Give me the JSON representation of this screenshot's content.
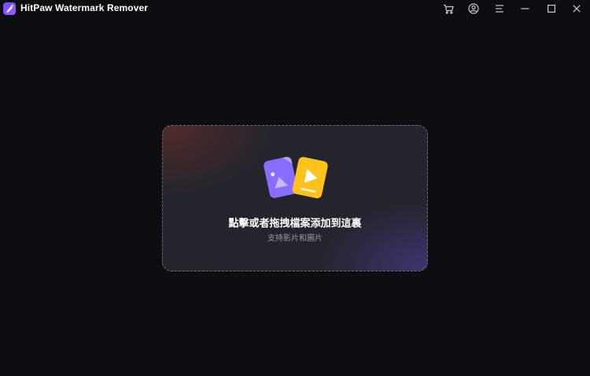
{
  "window": {
    "title": "HitPaw Watermark Remover"
  },
  "titlebar": {
    "icons": [
      "cart-icon",
      "account-icon",
      "menu-icon",
      "minimize-icon",
      "maximize-icon",
      "close-icon"
    ]
  },
  "drop_zone": {
    "title": "點擊或者拖拽檔案添加到這裏",
    "subtitle": "支持影片和圖片",
    "icons": [
      "image-file-icon",
      "video-file-icon"
    ]
  },
  "colors": {
    "background": "#0e0e12",
    "panel": "#24242c",
    "accent_purple": "#8a6cff",
    "accent_yellow": "#ffc21a",
    "subtitle": "#9a9aa6"
  }
}
